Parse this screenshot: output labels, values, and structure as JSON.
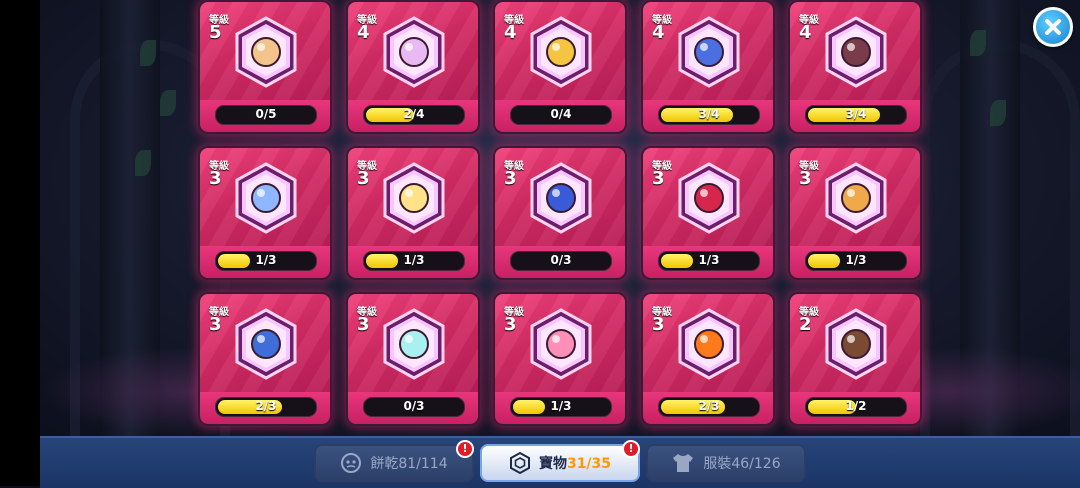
{
  "level_label": "等級",
  "treasures": [
    {
      "level": "5",
      "progress_text": "0/5",
      "fraction": 0.0,
      "icon": "scroll-treasure-icon",
      "color": "#f2c38a"
    },
    {
      "level": "4",
      "progress_text": "2/4",
      "fraction": 0.5,
      "icon": "ghost-treasure-icon",
      "color": "#e9b9f3"
    },
    {
      "level": "4",
      "progress_text": "0/4",
      "fraction": 0.0,
      "icon": "golden-crown-treasure-icon",
      "color": "#f5c542"
    },
    {
      "level": "4",
      "progress_text": "3/4",
      "fraction": 0.75,
      "icon": "blue-serpent-treasure-icon",
      "color": "#4b6ee0"
    },
    {
      "level": "4",
      "progress_text": "3/4",
      "fraction": 0.75,
      "icon": "radish-treasure-icon",
      "color": "#7a3b4a"
    },
    {
      "level": "3",
      "progress_text": "1/3",
      "fraction": 0.33,
      "icon": "pocket-watch-treasure-icon",
      "color": "#8fb7ff"
    },
    {
      "level": "3",
      "progress_text": "1/3",
      "fraction": 0.33,
      "icon": "flower-wreath-treasure-icon",
      "color": "#ffe28a"
    },
    {
      "level": "3",
      "progress_text": "0/3",
      "fraction": 0.0,
      "icon": "blue-dragon-treasure-icon",
      "color": "#3a5ad8"
    },
    {
      "level": "3",
      "progress_text": "1/3",
      "fraction": 0.33,
      "icon": "berry-treasure-icon",
      "color": "#d6264b"
    },
    {
      "level": "3",
      "progress_text": "1/3",
      "fraction": 0.33,
      "icon": "fox-mask-treasure-icon",
      "color": "#f0a94a"
    },
    {
      "level": "3",
      "progress_text": "2/3",
      "fraction": 0.67,
      "icon": "blue-crystal-treasure-icon",
      "color": "#3f6ed9"
    },
    {
      "level": "3",
      "progress_text": "0/3",
      "fraction": 0.0,
      "icon": "ice-coral-treasure-icon",
      "color": "#a9f0f0"
    },
    {
      "level": "3",
      "progress_text": "1/3",
      "fraction": 0.33,
      "icon": "pink-cat-treasure-icon",
      "color": "#ff8fb8"
    },
    {
      "level": "3",
      "progress_text": "2/3",
      "fraction": 0.67,
      "icon": "fire-gem-treasure-icon",
      "color": "#ff7a1a"
    },
    {
      "level": "2",
      "progress_text": "1/2",
      "fraction": 0.5,
      "icon": "sack-treasure-icon",
      "color": "#7a4a33"
    }
  ],
  "tabs": [
    {
      "label": "餅乾",
      "count": "81/114",
      "icon": "cookie-icon",
      "alert": "!"
    },
    {
      "label": "寶物",
      "count": "31/35",
      "icon": "treasure-hexagon-icon",
      "alert": "!"
    },
    {
      "label": "服裝",
      "count": "46/126",
      "icon": "costume-shirt-icon",
      "alert": ""
    }
  ],
  "colors": {
    "card_top": "#d12b63",
    "bar_fill": "#f2c500",
    "tab_bar": "#1b3465",
    "close_button": "#1d7fd0"
  }
}
